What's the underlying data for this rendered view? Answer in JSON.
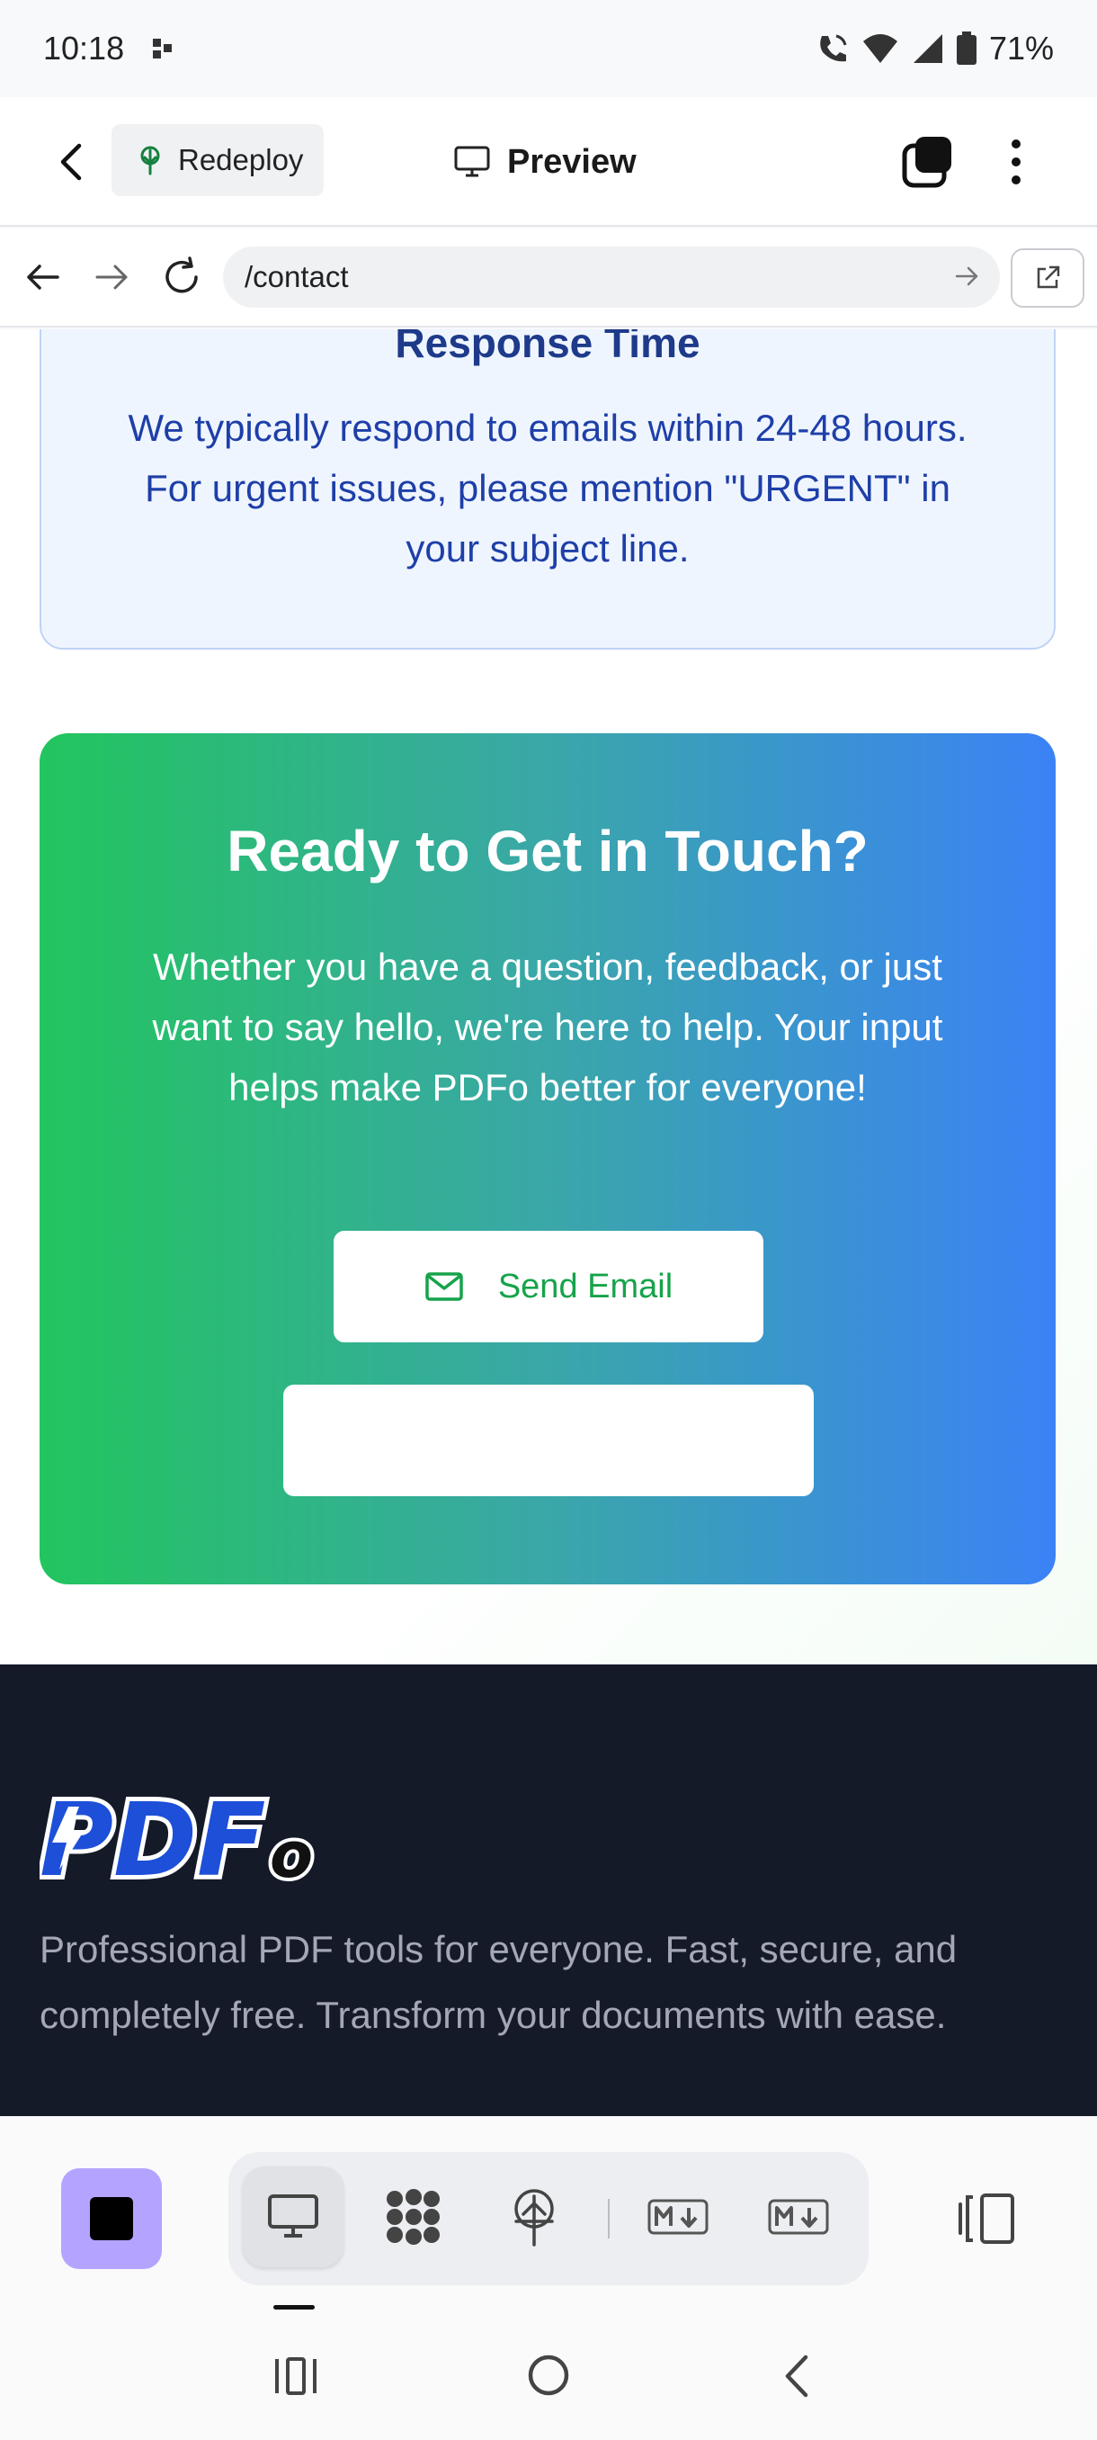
{
  "status_bar": {
    "time": "10:18",
    "battery": "71%",
    "icons": [
      "notification-dots-icon",
      "wifi-calling-icon",
      "wifi-icon",
      "cell-signal-icon",
      "battery-icon"
    ]
  },
  "header": {
    "back_icon": "chevron-left-icon",
    "redeploy_label": "Redeploy",
    "redeploy_icon": "tree-icon",
    "title": "Preview",
    "title_icon": "monitor-icon",
    "tabs_icon": "tabs-icon",
    "more_icon": "more-vertical-icon"
  },
  "url_bar": {
    "url": "/contact",
    "icons": [
      "arrow-back-icon",
      "arrow-forward-icon",
      "reload-icon",
      "arrow-go-icon",
      "open-external-icon"
    ]
  },
  "page": {
    "response_card": {
      "title": "Response Time",
      "text": "We typically respond to emails within 24-48 hours. For urgent issues, please mention \"URGENT\" in your subject line."
    },
    "cta": {
      "title": "Ready to Get in Touch?",
      "text": "Whether you have a question, feedback, or just want to say hello, we're here to help. Your input helps make PDFo better for everyone!",
      "send_email_label": "Send Email",
      "colors": {
        "gradient_start": "#22c55e",
        "gradient_end": "#3b82f6",
        "button_text": "#16a34a"
      }
    },
    "footer": {
      "logo_text": "PDFo",
      "description": "Professional PDF tools for everyone. Fast, secure, and completely free. Transform your documents with ease."
    }
  },
  "toolbar": {
    "stop_icon": "stop-icon",
    "modes": [
      {
        "icon": "monitor-icon",
        "active": true
      },
      {
        "icon": "grid-blobs-icon",
        "active": false
      },
      {
        "icon": "tree-upload-icon",
        "active": false
      },
      {
        "icon": "markdown-download-icon",
        "active": false
      },
      {
        "icon": "markdown-download-icon",
        "active": false
      }
    ],
    "split_icon": "split-view-icon",
    "accent": "#b4a4ff"
  },
  "system_nav": [
    "recent-apps-icon",
    "home-icon",
    "back-icon"
  ]
}
